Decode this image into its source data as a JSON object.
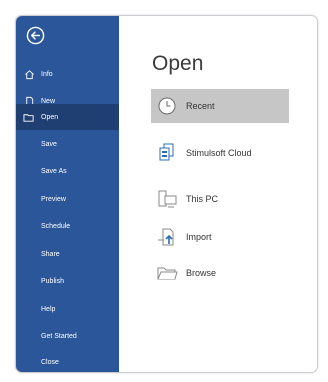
{
  "sidebar": {
    "primary_items": [
      {
        "label": "Info",
        "icon": "home-icon"
      },
      {
        "label": "New",
        "icon": "new-doc-icon"
      },
      {
        "label": "Open",
        "icon": "folder-open-icon"
      }
    ],
    "secondary_items": [
      {
        "label": "Save"
      },
      {
        "label": "Save As"
      },
      {
        "label": "Preview"
      },
      {
        "label": "Schedule"
      },
      {
        "label": "Share"
      },
      {
        "label": "Publish"
      },
      {
        "label": "Help"
      },
      {
        "label": "Get Started"
      },
      {
        "label": "Close"
      }
    ],
    "active_item": "Open"
  },
  "main": {
    "title": "Open",
    "places": [
      {
        "label": "Recent",
        "icon": "clock-icon",
        "selected": true
      },
      {
        "label": "Stimulsoft Cloud",
        "icon": "cloud-docs-icon",
        "selected": false
      },
      {
        "label": "This PC",
        "icon": "computer-icon",
        "selected": false
      },
      {
        "label": "Import",
        "icon": "import-icon",
        "selected": false
      },
      {
        "label": "Browse",
        "icon": "folder-icon",
        "selected": false
      }
    ]
  },
  "colors": {
    "sidebar": "#2b579a",
    "sidebar_active": "#1f3f72",
    "selected_place": "#c6c6c6"
  }
}
